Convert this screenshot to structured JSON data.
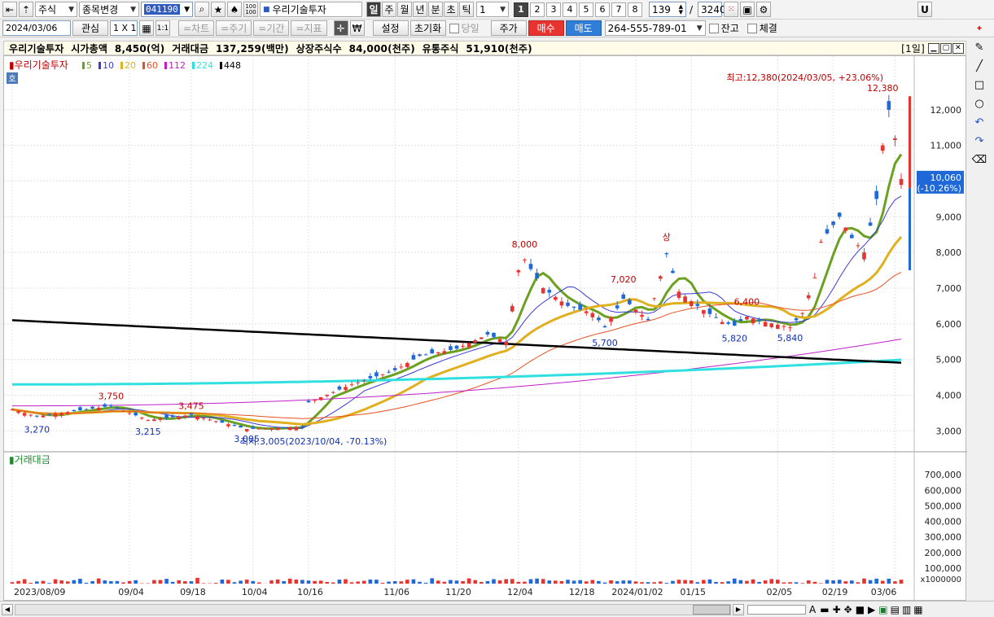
{
  "toolbar1": {
    "market_label": "주식",
    "change_label": "종목변경",
    "code": "041190",
    "stock_name": "우리기술투자",
    "period_buttons": [
      "일",
      "주",
      "월",
      "년",
      "분",
      "초",
      "틱"
    ],
    "interval_value": "1",
    "num_buttons": [
      "1",
      "2",
      "3",
      "4",
      "5",
      "6",
      "7",
      "8"
    ],
    "count_value": "139",
    "slash": "/",
    "total_value": "3240",
    "right_button": "U"
  },
  "toolbar2": {
    "date_value": "2024/03/06",
    "interest_label": "관심",
    "grid_label": "1 X 1",
    "one_one_label": "1:1",
    "chart_btn": "=차트",
    "period_btn": "=주기",
    "range_btn": "=기간",
    "indicator_btn": "=지표",
    "settings_label": "설정",
    "reset_label": "초기화",
    "sameday_label": "당일",
    "price_label": "주가",
    "buy_label": "매수",
    "sell_label": "매도",
    "account_value": "264-555-789-01",
    "balance_label": "잔고",
    "filled_label": "체결"
  },
  "infobar": {
    "text": "우리기술투자  시가총액  8,450(억)  거래대금  137,259(백만)  상장주식수  84,000(천주)  유통주식  51,910(천주)",
    "period_tag": "[1일]"
  },
  "chart_data": {
    "type": "candlestick",
    "title": "우리기술투자",
    "ma_legend": [
      {
        "label": "5",
        "color": "#6aa121"
      },
      {
        "label": "10",
        "color": "#3a3ad8"
      },
      {
        "label": "20",
        "color": "#e0b020"
      },
      {
        "label": "60",
        "color": "#e85020"
      },
      {
        "label": "112",
        "color": "#c020c8"
      },
      {
        "label": "224",
        "color": "#30e0e0"
      },
      {
        "label": "448",
        "color": "#000000"
      }
    ],
    "hoga_tag": "호",
    "price_ticks": [
      3000,
      4000,
      5000,
      6000,
      7000,
      8000,
      9000,
      10000,
      11000,
      12000
    ],
    "price_tick_labels": [
      "3,000",
      "4,000",
      "5,000",
      "6,000",
      "7,000",
      "8,000",
      "9,000",
      "10,000",
      "11,000",
      "12,000"
    ],
    "price_range": [
      2550,
      13000
    ],
    "date_labels": [
      {
        "i": 0,
        "label": "2023/08/09"
      },
      {
        "i": 19,
        "label": "09/04"
      },
      {
        "i": 29,
        "label": "09/18"
      },
      {
        "i": 39,
        "label": "10/04"
      },
      {
        "i": 48,
        "label": "10/16"
      },
      {
        "i": 62,
        "label": "11/06"
      },
      {
        "i": 72,
        "label": "11/20"
      },
      {
        "i": 82,
        "label": "12/04"
      },
      {
        "i": 92,
        "label": "12/18"
      },
      {
        "i": 101,
        "label": "2024/01/02"
      },
      {
        "i": 110,
        "label": "01/15"
      },
      {
        "i": 124,
        "label": "02/05"
      },
      {
        "i": 133,
        "label": "02/19"
      },
      {
        "i": 143,
        "label": "03/06"
      }
    ],
    "annotations": [
      {
        "i": 4,
        "price": 3270,
        "label": "3,270",
        "color": "#1030b0",
        "pos": "below"
      },
      {
        "i": 16,
        "price": 3750,
        "label": "3,750",
        "color": "#c00000",
        "pos": "above"
      },
      {
        "i": 22,
        "price": 3215,
        "label": "3,215",
        "color": "#1030b0",
        "pos": "below"
      },
      {
        "i": 29,
        "price": 3475,
        "label": "3,475",
        "color": "#c00000",
        "pos": "above"
      },
      {
        "i": 38,
        "price": 3005,
        "label": "3,005",
        "color": "#1030b0",
        "pos": "below"
      },
      {
        "i": 83,
        "price": 8000,
        "label": "8,000",
        "color": "#c00000",
        "pos": "above"
      },
      {
        "i": 99,
        "price": 7020,
        "label": "7,020",
        "color": "#c00000",
        "pos": "above"
      },
      {
        "i": 96,
        "price": 5700,
        "label": "5,700",
        "color": "#1030b0",
        "pos": "below"
      },
      {
        "i": 117,
        "price": 5820,
        "label": "5,820",
        "color": "#1030b0",
        "pos": "below"
      },
      {
        "i": 119,
        "price": 6400,
        "label": "6,400",
        "color": "#c00000",
        "pos": "above"
      },
      {
        "i": 126,
        "price": 5840,
        "label": "5,840",
        "color": "#1030b0",
        "pos": "below"
      },
      {
        "i": 141,
        "price": 12380,
        "label": "12,380",
        "color": "#c00000",
        "pos": "above"
      }
    ],
    "upper_limit_mark": {
      "i": 106,
      "label": "상"
    },
    "high_label": "최고:12,380(2024/03/05, +23.06%)",
    "low_label": "최저:3,005(2023/10/04, -70.13%)",
    "last_price_label": "10,060",
    "last_change_label": "(-10.26%)",
    "last_price": 10060,
    "volume_legend": "거래대금",
    "volume_ticks": [
      100000,
      200000,
      300000,
      400000,
      500000,
      600000,
      700000
    ],
    "volume_tick_labels": [
      "100,000",
      "200,000",
      "300,000",
      "400,000",
      "500,000",
      "600,000",
      "700,000"
    ],
    "volume_unit": "x1000000",
    "volume_range": [
      0,
      800000
    ]
  },
  "bottombar": {
    "zoom_glyph": "A"
  }
}
